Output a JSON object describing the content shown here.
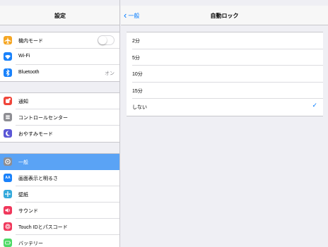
{
  "status_bar": {
    "device": "iPad",
    "wifi_icon": "wifi-icon"
  },
  "colors": {
    "accent": "#007aff",
    "selected_row": "#5aa3f5",
    "background": "#efeff4"
  },
  "master": {
    "title": "設定",
    "groups": [
      {
        "items": [
          {
            "label": "機内モード",
            "icon": "airplane-icon",
            "color": "#f5a623",
            "control": "toggle",
            "toggle_on": false
          },
          {
            "label": "Wi-Fi",
            "icon": "wifi-icon",
            "color": "#1a82fb"
          },
          {
            "label": "Bluetooth",
            "icon": "bluetooth-icon",
            "color": "#1a82fb",
            "value": "オン"
          }
        ]
      },
      {
        "items": [
          {
            "label": "通知",
            "icon": "notifications-icon",
            "color": "#f0453a"
          },
          {
            "label": "コントロールセンター",
            "icon": "control-center-icon",
            "color": "#8e8e93"
          },
          {
            "label": "おやすみモード",
            "icon": "moon-icon",
            "color": "#5b57d6"
          }
        ]
      },
      {
        "items": [
          {
            "label": "一般",
            "icon": "gear-icon",
            "color": "#8e8e93",
            "selected": true
          },
          {
            "label": "画面表示と明るさ",
            "icon": "display-brightness-icon",
            "color": "#1a82fb"
          },
          {
            "label": "壁紙",
            "icon": "wallpaper-icon",
            "color": "#35aadc"
          },
          {
            "label": "サウンド",
            "icon": "sound-icon",
            "color": "#f0375b"
          },
          {
            "label": "Touch IDとパスコード",
            "icon": "fingerprint-icon",
            "color": "#f0375b"
          },
          {
            "label": "バッテリー",
            "icon": "battery-icon",
            "color": "#4cd964"
          }
        ]
      }
    ]
  },
  "detail": {
    "back_label": "一般",
    "title": "自動ロック",
    "options": [
      {
        "label": "2分",
        "checked": false
      },
      {
        "label": "5分",
        "checked": false
      },
      {
        "label": "10分",
        "checked": false
      },
      {
        "label": "15分",
        "checked": false
      },
      {
        "label": "しない",
        "checked": true
      }
    ]
  }
}
